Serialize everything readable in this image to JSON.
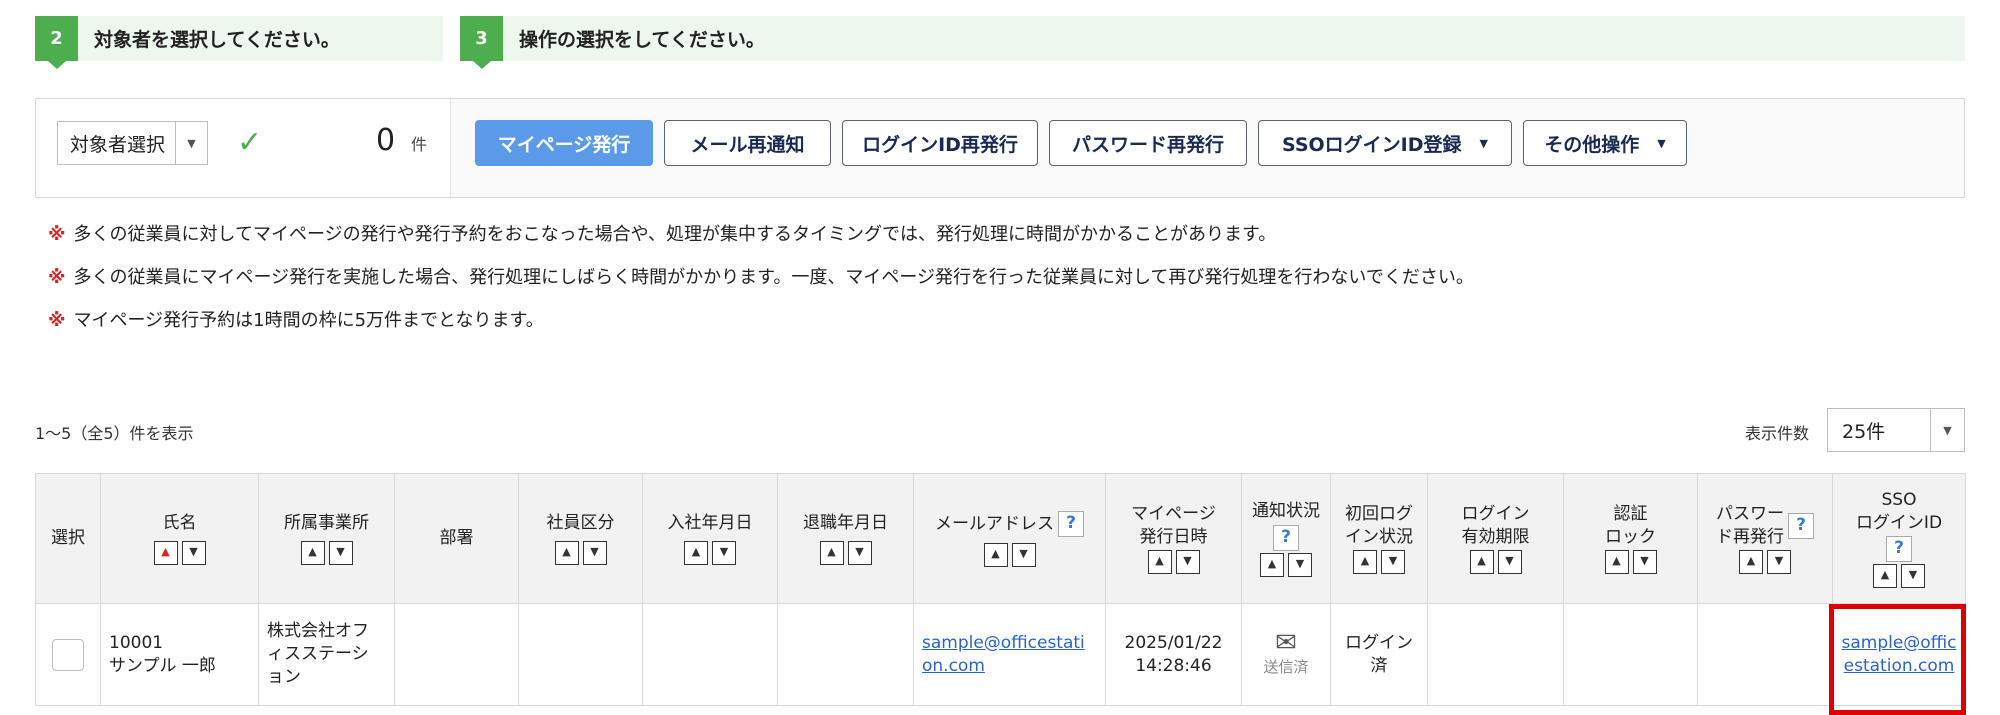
{
  "steps": [
    {
      "number": "2",
      "label": "対象者を選択してください。"
    },
    {
      "number": "3",
      "label": "操作の選択をしてください。"
    }
  ],
  "target": {
    "select_label": "対象者選択",
    "count": "0",
    "count_unit": "件"
  },
  "actions": {
    "mypage_issue": "マイページ発行",
    "mail_renotify": "メール再通知",
    "loginid_reissue": "ログインID再発行",
    "password_reissue": "パスワード再発行",
    "sso_register": "SSOログインID登録",
    "other": "その他操作"
  },
  "notes": {
    "mark": "※",
    "items": [
      "多くの従業員に対してマイページの発行や発行予約をおこなった場合や、処理が集中するタイミングでは、発行処理に時間がかかることがあります。",
      "多くの従業員にマイページ発行を実施した場合、発行処理にしばらく時間がかかります。一度、マイページ発行を行った従業員に対して再び発行処理を行わないでください。",
      "マイページ発行予約は1時間の枠に5万件までとなります。"
    ]
  },
  "results": {
    "summary": "1～5（全5）件を表示",
    "perpage_label": "表示件数",
    "perpage_value": "25件"
  },
  "table": {
    "headers": {
      "select": "選択",
      "name": "氏名",
      "office": "所属事業所",
      "department": "部署",
      "employee_type": "社員区分",
      "join_date": "入社年月日",
      "leave_date": "退職年月日",
      "email": "メールアドレス",
      "mypage_date_1": "マイページ",
      "mypage_date_2": "発行日時",
      "notify_status": "通知状況",
      "first_login_1": "初回ログ",
      "first_login_2": "イン状況",
      "login_expiry_1": "ログイン",
      "login_expiry_2": "有効期限",
      "auth_lock_1": "認証",
      "auth_lock_2": "ロック",
      "pw_reissue_1": "パスワー",
      "pw_reissue_2": "ド再発行",
      "sso_1": "SSO",
      "sso_2": "ログインID",
      "help": "?"
    },
    "rows": [
      {
        "employee_id": "10001",
        "name": "サンプル 一郎",
        "office_1": "株式会社オフ",
        "office_2": "ィスステーシ",
        "office_3": "ョン",
        "department": "",
        "employee_type": "",
        "join_date": "",
        "leave_date": "",
        "email_1": "sample@officestati",
        "email_2": "on.com",
        "mypage_date": "2025/01/22",
        "mypage_time": "14:28:46",
        "notify_status": "送信済",
        "first_login_1": "ログイン",
        "first_login_2": "済",
        "login_expiry": "",
        "auth_lock": "",
        "pw_reissue": "",
        "sso_1": "sample@offic",
        "sso_2": "estation.com"
      }
    ]
  },
  "icons": {
    "check": "check-icon",
    "mail": "mail-icon",
    "sort_up": "sort-up-icon",
    "sort_down": "sort-down-icon",
    "dropdown": "chevron-down-icon"
  },
  "colors": {
    "step_badge": "#4cae4c",
    "primary_button": "#5b9ae8",
    "link": "#2a63c7",
    "highlight": "#e00000",
    "note_mark": "#dd2222"
  }
}
